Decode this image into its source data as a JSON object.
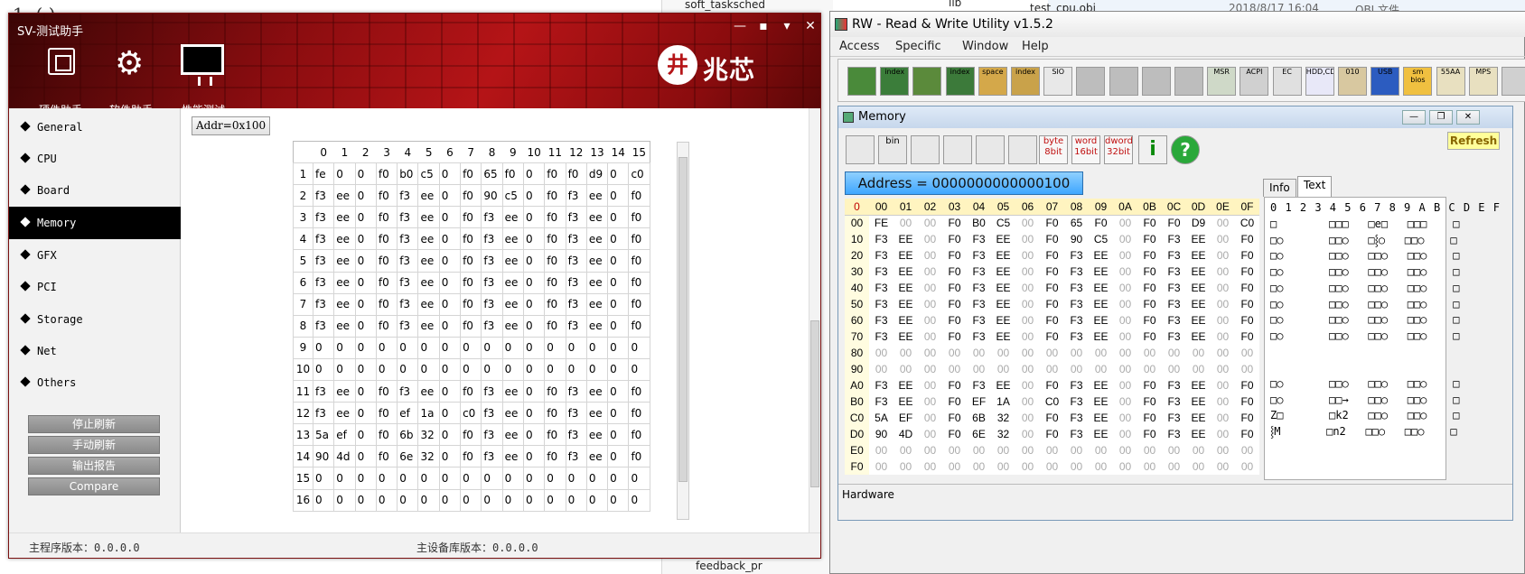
{
  "sv": {
    "title": "SV-测试助手",
    "controls": [
      "—",
      "▪",
      "▾",
      "✕"
    ],
    "tools": [
      {
        "label": "硬件助手"
      },
      {
        "label": "软件助手"
      },
      {
        "label": "性能测试"
      }
    ],
    "logo": "兆芯",
    "nav": [
      "General",
      "CPU",
      "Board",
      "Memory",
      "GFX",
      "PCI",
      "Storage",
      "Net",
      "Others"
    ],
    "selected_nav": "Memory",
    "buttons": [
      "停止刷新",
      "手动刷新",
      "输出报告",
      "Compare"
    ],
    "addr_label": "Addr=0x100",
    "grid_header": [
      "",
      "0",
      "1",
      "2",
      "3",
      "4",
      "5",
      "6",
      "7",
      "8",
      "9",
      "10",
      "11",
      "12",
      "13",
      "14",
      "15"
    ],
    "grid_rows": [
      [
        "1",
        "fe",
        "0",
        "0",
        "f0",
        "b0",
        "c5",
        "0",
        "f0",
        "65",
        "f0",
        "0",
        "f0",
        "f0",
        "d9",
        "0",
        "c0"
      ],
      [
        "2",
        "f3",
        "ee",
        "0",
        "f0",
        "f3",
        "ee",
        "0",
        "f0",
        "90",
        "c5",
        "0",
        "f0",
        "f3",
        "ee",
        "0",
        "f0"
      ],
      [
        "3",
        "f3",
        "ee",
        "0",
        "f0",
        "f3",
        "ee",
        "0",
        "f0",
        "f3",
        "ee",
        "0",
        "f0",
        "f3",
        "ee",
        "0",
        "f0"
      ],
      [
        "4",
        "f3",
        "ee",
        "0",
        "f0",
        "f3",
        "ee",
        "0",
        "f0",
        "f3",
        "ee",
        "0",
        "f0",
        "f3",
        "ee",
        "0",
        "f0"
      ],
      [
        "5",
        "f3",
        "ee",
        "0",
        "f0",
        "f3",
        "ee",
        "0",
        "f0",
        "f3",
        "ee",
        "0",
        "f0",
        "f3",
        "ee",
        "0",
        "f0"
      ],
      [
        "6",
        "f3",
        "ee",
        "0",
        "f0",
        "f3",
        "ee",
        "0",
        "f0",
        "f3",
        "ee",
        "0",
        "f0",
        "f3",
        "ee",
        "0",
        "f0"
      ],
      [
        "7",
        "f3",
        "ee",
        "0",
        "f0",
        "f3",
        "ee",
        "0",
        "f0",
        "f3",
        "ee",
        "0",
        "f0",
        "f3",
        "ee",
        "0",
        "f0"
      ],
      [
        "8",
        "f3",
        "ee",
        "0",
        "f0",
        "f3",
        "ee",
        "0",
        "f0",
        "f3",
        "ee",
        "0",
        "f0",
        "f3",
        "ee",
        "0",
        "f0"
      ],
      [
        "9",
        "0",
        "0",
        "0",
        "0",
        "0",
        "0",
        "0",
        "0",
        "0",
        "0",
        "0",
        "0",
        "0",
        "0",
        "0",
        "0"
      ],
      [
        "10",
        "0",
        "0",
        "0",
        "0",
        "0",
        "0",
        "0",
        "0",
        "0",
        "0",
        "0",
        "0",
        "0",
        "0",
        "0",
        "0"
      ],
      [
        "11",
        "f3",
        "ee",
        "0",
        "f0",
        "f3",
        "ee",
        "0",
        "f0",
        "f3",
        "ee",
        "0",
        "f0",
        "f3",
        "ee",
        "0",
        "f0"
      ],
      [
        "12",
        "f3",
        "ee",
        "0",
        "f0",
        "ef",
        "1a",
        "0",
        "c0",
        "f3",
        "ee",
        "0",
        "f0",
        "f3",
        "ee",
        "0",
        "f0"
      ],
      [
        "13",
        "5a",
        "ef",
        "0",
        "f0",
        "6b",
        "32",
        "0",
        "f0",
        "f3",
        "ee",
        "0",
        "f0",
        "f3",
        "ee",
        "0",
        "f0"
      ],
      [
        "14",
        "90",
        "4d",
        "0",
        "f0",
        "6e",
        "32",
        "0",
        "f0",
        "f3",
        "ee",
        "0",
        "f0",
        "f3",
        "ee",
        "0",
        "f0"
      ],
      [
        "15",
        "0",
        "0",
        "0",
        "0",
        "0",
        "0",
        "0",
        "0",
        "0",
        "0",
        "0",
        "0",
        "0",
        "0",
        "0",
        "0"
      ],
      [
        "16",
        "0",
        "0",
        "0",
        "0",
        "0",
        "0",
        "0",
        "0",
        "0",
        "0",
        "0",
        "0",
        "0",
        "0",
        "0",
        "0"
      ]
    ],
    "footer_left": "主程序版本：0.0.0.0",
    "footer_right": "主设备库版本：0.0.0.0"
  },
  "background": {
    "tree_top": "soft_tasksched",
    "tree_lib": "lib",
    "file_top": "test_cpu.obj",
    "file_date": "2018/8/17 16:04",
    "file_type": "OBJ 文件",
    "tree_bottom": "feedback_pr"
  },
  "rw": {
    "title": "RW - Read & Write Utility v1.5.2",
    "menu": [
      "Access",
      "Specific",
      "Window",
      "Help"
    ],
    "toolbar": [
      "",
      "index",
      "",
      "index",
      "space",
      "index",
      "SIO",
      "",
      "",
      "",
      "",
      "MSR",
      "ACPI",
      "EC",
      "HDD,CD",
      "010",
      "USB",
      "sm bios",
      "55AA",
      "MPS",
      ""
    ],
    "mem_title": "Memory",
    "mem_toolbar": [
      "",
      "bin",
      "",
      "",
      "",
      "",
      "byte 8bit",
      "word 16bit",
      "dword 32bit",
      "i",
      "?"
    ],
    "refresh": "Refresh",
    "address": "Address = 0000000000000100",
    "hex_header": [
      "0",
      "00",
      "01",
      "02",
      "03",
      "04",
      "05",
      "06",
      "07",
      "08",
      "09",
      "0A",
      "0B",
      "0C",
      "0D",
      "0E",
      "0F"
    ],
    "hex_rows": [
      [
        "00",
        "FE",
        "00",
        "00",
        "F0",
        "B0",
        "C5",
        "00",
        "F0",
        "65",
        "F0",
        "00",
        "F0",
        "F0",
        "D9",
        "00",
        "C0"
      ],
      [
        "10",
        "F3",
        "EE",
        "00",
        "F0",
        "F3",
        "EE",
        "00",
        "F0",
        "90",
        "C5",
        "00",
        "F0",
        "F3",
        "EE",
        "00",
        "F0"
      ],
      [
        "20",
        "F3",
        "EE",
        "00",
        "F0",
        "F3",
        "EE",
        "00",
        "F0",
        "F3",
        "EE",
        "00",
        "F0",
        "F3",
        "EE",
        "00",
        "F0"
      ],
      [
        "30",
        "F3",
        "EE",
        "00",
        "F0",
        "F3",
        "EE",
        "00",
        "F0",
        "F3",
        "EE",
        "00",
        "F0",
        "F3",
        "EE",
        "00",
        "F0"
      ],
      [
        "40",
        "F3",
        "EE",
        "00",
        "F0",
        "F3",
        "EE",
        "00",
        "F0",
        "F3",
        "EE",
        "00",
        "F0",
        "F3",
        "EE",
        "00",
        "F0"
      ],
      [
        "50",
        "F3",
        "EE",
        "00",
        "F0",
        "F3",
        "EE",
        "00",
        "F0",
        "F3",
        "EE",
        "00",
        "F0",
        "F3",
        "EE",
        "00",
        "F0"
      ],
      [
        "60",
        "F3",
        "EE",
        "00",
        "F0",
        "F3",
        "EE",
        "00",
        "F0",
        "F3",
        "EE",
        "00",
        "F0",
        "F3",
        "EE",
        "00",
        "F0"
      ],
      [
        "70",
        "F3",
        "EE",
        "00",
        "F0",
        "F3",
        "EE",
        "00",
        "F0",
        "F3",
        "EE",
        "00",
        "F0",
        "F3",
        "EE",
        "00",
        "F0"
      ],
      [
        "80",
        "00",
        "00",
        "00",
        "00",
        "00",
        "00",
        "00",
        "00",
        "00",
        "00",
        "00",
        "00",
        "00",
        "00",
        "00",
        "00"
      ],
      [
        "90",
        "00",
        "00",
        "00",
        "00",
        "00",
        "00",
        "00",
        "00",
        "00",
        "00",
        "00",
        "00",
        "00",
        "00",
        "00",
        "00"
      ],
      [
        "A0",
        "F3",
        "EE",
        "00",
        "F0",
        "F3",
        "EE",
        "00",
        "F0",
        "F3",
        "EE",
        "00",
        "F0",
        "F3",
        "EE",
        "00",
        "F0"
      ],
      [
        "B0",
        "F3",
        "EE",
        "00",
        "F0",
        "EF",
        "1A",
        "00",
        "C0",
        "F3",
        "EE",
        "00",
        "F0",
        "F3",
        "EE",
        "00",
        "F0"
      ],
      [
        "C0",
        "5A",
        "EF",
        "00",
        "F0",
        "6B",
        "32",
        "00",
        "F0",
        "F3",
        "EE",
        "00",
        "F0",
        "F3",
        "EE",
        "00",
        "F0"
      ],
      [
        "D0",
        "90",
        "4D",
        "00",
        "F0",
        "6E",
        "32",
        "00",
        "F0",
        "F3",
        "EE",
        "00",
        "F0",
        "F3",
        "EE",
        "00",
        "F0"
      ],
      [
        "E0",
        "00",
        "00",
        "00",
        "00",
        "00",
        "00",
        "00",
        "00",
        "00",
        "00",
        "00",
        "00",
        "00",
        "00",
        "00",
        "00"
      ],
      [
        "F0",
        "00",
        "00",
        "00",
        "00",
        "00",
        "00",
        "00",
        "00",
        "00",
        "00",
        "00",
        "00",
        "00",
        "00",
        "00",
        "00"
      ]
    ],
    "tabs": [
      "Info",
      "Text"
    ],
    "text_header": "0 1 2 3 4 5 6 7 8 9 A B C D E F",
    "text_rows": [
      "□        □□□   □e□   □□□    □",
      "□○       □□○   □⸾○   □□○    □",
      "□○       □□○   □□○   □□○    □",
      "□○       □□○   □□○   □□○    □",
      "□○       □□○   □□○   □□○    □",
      "□○       □□○   □□○   □□○    □",
      "□○       □□○   □□○   □□○    □",
      "□○       □□○   □□○   □□○    □",
      "",
      "",
      "□○       □□○   □□○   □□○    □",
      "□○       □□→   □□○   □□○    □",
      "Z□       □k2   □□○   □□○    □",
      "⸾M       □n2   □□○   □□○    □",
      "",
      ""
    ],
    "status": "Hardware"
  }
}
